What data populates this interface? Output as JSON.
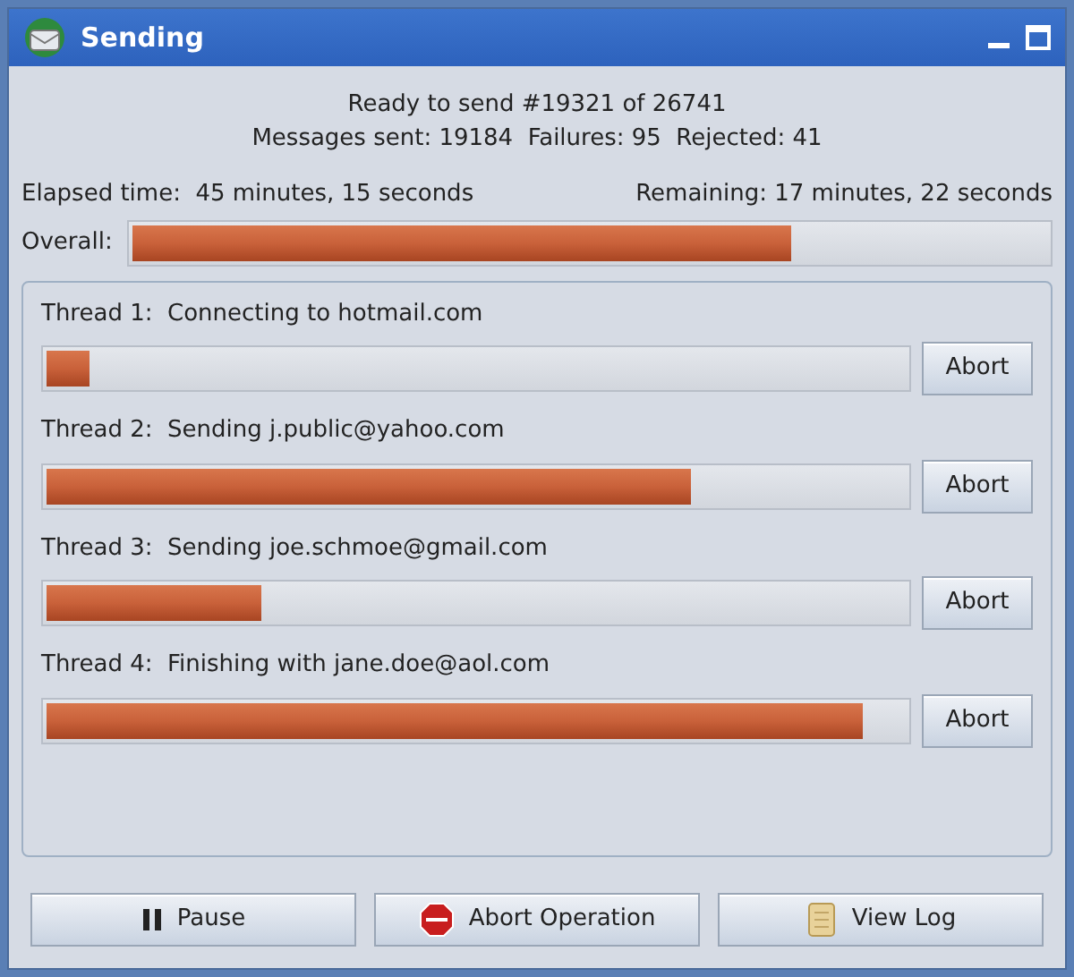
{
  "window": {
    "title": "Sending"
  },
  "status": {
    "line_1": "Ready to send #19321 of 26741",
    "line_2": "Messages sent: 19184  Failures: 95  Rejected: 41"
  },
  "elapsed": {
    "label": "Elapsed time:",
    "value": "45 minutes, 15 seconds"
  },
  "remaining": {
    "label": "Remaining:",
    "value": "17 minutes, 22 seconds"
  },
  "overall": {
    "label": "Overall:",
    "level": 0.72
  },
  "threads": [
    {
      "label": "Thread 1:",
      "activity": "Connecting to hotmail.com",
      "level": 0.05,
      "button": "Abort"
    },
    {
      "label": "Thread 2:",
      "activity": "Sending j.public@yahoo.com",
      "level": 0.75,
      "button": "Abort"
    },
    {
      "label": "Thread 3:",
      "activity": "Sending joe.schmoe@gmail.com",
      "level": 0.25,
      "button": "Abort"
    },
    {
      "label": "Thread 4:",
      "activity": "Finishing with jane.doe@aol.com",
      "level": 0.95,
      "button": "Abort"
    }
  ],
  "buttons": [
    {
      "kind": "pause",
      "label": "Pause"
    },
    {
      "kind": "stop",
      "label": "Abort Operation"
    },
    {
      "kind": "log",
      "label": "View Log"
    }
  ]
}
